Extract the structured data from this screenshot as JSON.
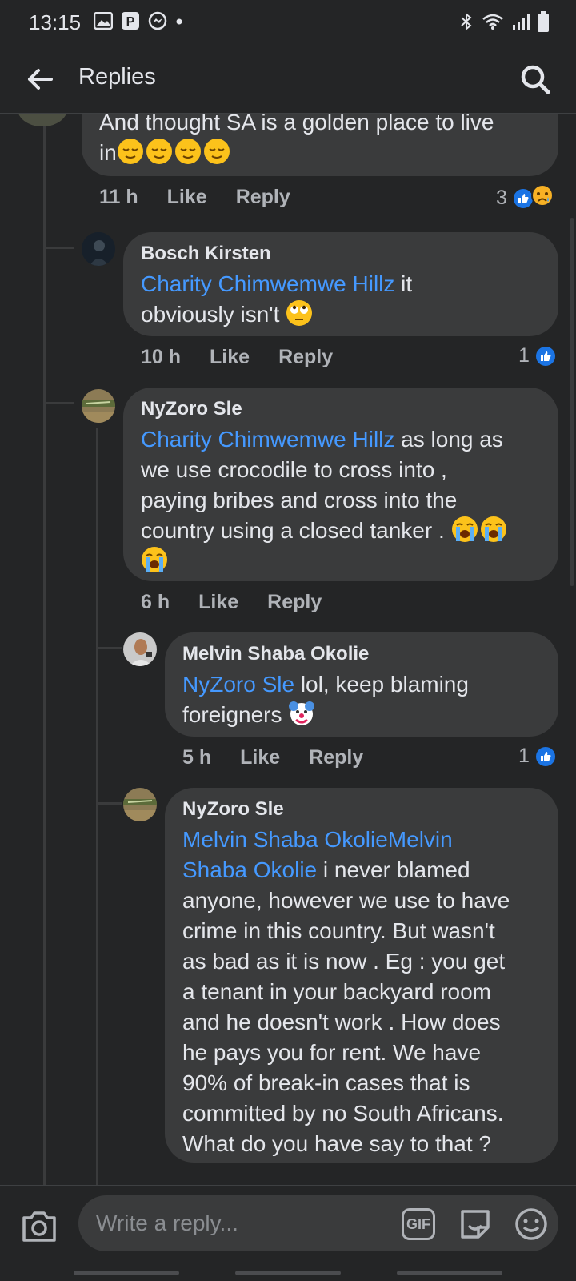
{
  "status": {
    "time": "13:15",
    "left_icons": [
      "image-icon",
      "parking-icon",
      "messenger-icon",
      "dot-icon"
    ],
    "right_icons": [
      "bluetooth-icon",
      "wifi-icon",
      "signal-icon",
      "battery-icon"
    ]
  },
  "header": {
    "title": "Replies"
  },
  "colors": {
    "background": "#242526",
    "bubble": "#3a3b3c",
    "mention": "#4599ff",
    "like_blue": "#1b74e4",
    "muted": "#b0b3b8"
  },
  "comments": [
    {
      "text_line1": "And thought SA is a golden place to live",
      "text_line2": "in",
      "emojis": [
        "relieved-face",
        "relieved-face",
        "relieved-face",
        "relieved-face"
      ],
      "time": "11 h",
      "like_label": "Like",
      "reply_label": "Reply",
      "reaction_count": "3",
      "reactions": [
        "like-reaction-icon",
        "sad-reaction-icon"
      ]
    },
    {
      "author": "Bosch Kirsten",
      "mention": "Charity Chimwemwe Hillz",
      "text_a": " it",
      "text_b": "obviously isn't ",
      "emojis": [
        "eye-roll-face"
      ],
      "time": "10 h",
      "like_label": "Like",
      "reply_label": "Reply",
      "reaction_count": "1"
    },
    {
      "author": "NyZoro Sle",
      "mention": "Charity Chimwemwe Hillz",
      "text_a": " as long as",
      "lines": [
        "we use crocodile to cross into ,",
        "paying bribes and cross into the",
        "country using a closed tanker . "
      ],
      "emojis": [
        "loudly-crying-face",
        "loudly-crying-face",
        "loudly-crying-face"
      ],
      "time": "6 h",
      "like_label": "Like",
      "reply_label": "Reply"
    },
    {
      "author": "Melvin Shaba Okolie",
      "mention": "NyZoro Sle",
      "text_a": " lol, keep blaming",
      "text_b": "foreigners ",
      "emojis": [
        "clown-face"
      ],
      "time": "5 h",
      "like_label": "Like",
      "reply_label": "Reply",
      "reaction_count": "1"
    },
    {
      "author": "NyZoro Sle",
      "mention_line1": "Melvin Shaba OkolieMelvin",
      "mention_line2": "Shaba Okolie",
      "text_a": " i never blamed",
      "lines": [
        "anyone, however we use to have",
        "crime in this country. But wasn't",
        "as bad as it is now . Eg : you get",
        "a tenant in your backyard room",
        "and he doesn't work . How does",
        "he pays you for rent.  We have",
        "90% of break-in cases that is",
        "committed by no South Africans.",
        "What do you have say to that ?"
      ]
    }
  ],
  "composer": {
    "placeholder": "Write a reply...",
    "gif_label": "GIF"
  }
}
